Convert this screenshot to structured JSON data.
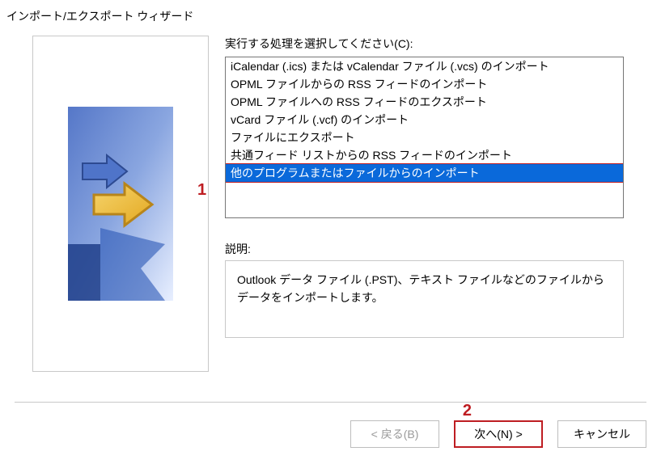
{
  "title": "インポート/エクスポート ウィザード",
  "prompt_label": "実行する処理を選択してください(C):",
  "options": [
    "iCalendar (.ics) または vCalendar ファイル (.vcs) のインポート",
    "OPML ファイルからの RSS フィードのインポート",
    "OPML ファイルへの RSS フィードのエクスポート",
    "vCard ファイル (.vcf) のインポート",
    "ファイルにエクスポート",
    "共通フィード リストからの RSS フィードのインポート",
    "他のプログラムまたはファイルからのインポート"
  ],
  "selected_index": 6,
  "description_label": "説明:",
  "description_text": "Outlook データ ファイル (.PST)、テキスト ファイルなどのファイルからデータをインポートします。",
  "buttons": {
    "back": "< 戻る(B)",
    "next": "次へ(N) >",
    "cancel": "キャンセル"
  },
  "annotations": {
    "one": "1",
    "two": "2"
  }
}
